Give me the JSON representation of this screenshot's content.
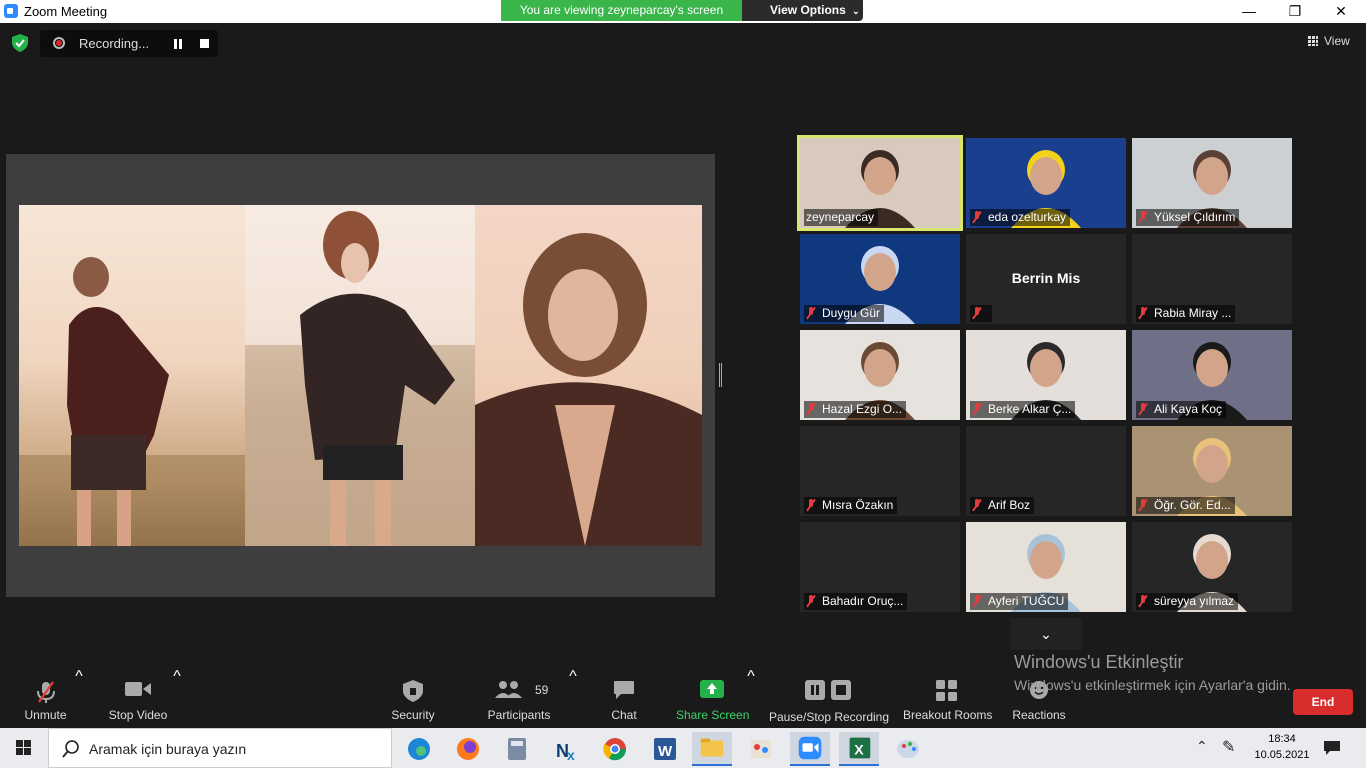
{
  "window": {
    "title": "Zoom Meeting",
    "minimize": "—",
    "restore": "❐",
    "close": "✕"
  },
  "banner": {
    "viewing": "You are viewing zeyneparcay's screen",
    "view_options": "View Options"
  },
  "recording": {
    "label": "Recording..."
  },
  "view": {
    "label": "View"
  },
  "gallery": [
    {
      "name": "zeyneparcay",
      "muted": false,
      "active": true,
      "video": true
    },
    {
      "name": "eda ozelturkay",
      "muted": true,
      "active": false,
      "video": true
    },
    {
      "name": "Yüksel Çıldırım",
      "muted": true,
      "active": false,
      "video": true
    },
    {
      "name": "Duygu Gür",
      "muted": true,
      "active": false,
      "video": true
    },
    {
      "name": "",
      "display_name": "Berrin Mis",
      "muted": true,
      "active": false,
      "video": false
    },
    {
      "name": "Rabia Miray ...",
      "muted": true,
      "active": false,
      "video": false
    },
    {
      "name": "Hazal Ezgi O...",
      "muted": true,
      "active": false,
      "video": true
    },
    {
      "name": "Berke Alkar Ç...",
      "muted": true,
      "active": false,
      "video": true
    },
    {
      "name": "Ali Kaya Koç",
      "muted": true,
      "active": false,
      "video": true
    },
    {
      "name": "Mısra Özakın",
      "muted": true,
      "active": false,
      "video": false
    },
    {
      "name": "Arif Boz",
      "muted": true,
      "active": false,
      "video": false
    },
    {
      "name": "Öğr. Gör. Ed...",
      "muted": true,
      "active": false,
      "video": true
    },
    {
      "name": "Bahadır Oruç...",
      "muted": true,
      "active": false,
      "video": false
    },
    {
      "name": "Ayferi TUĞCU",
      "muted": true,
      "active": false,
      "video": true
    },
    {
      "name": "süreyya yılmaz",
      "muted": true,
      "active": false,
      "video": true
    }
  ],
  "toolbar": {
    "unmute": "Unmute",
    "stop_video": "Stop Video",
    "security": "Security",
    "participants": "Participants",
    "participants_count": "59",
    "chat": "Chat",
    "share_screen": "Share Screen",
    "pause_stop_recording": "Pause/Stop Recording",
    "breakout_rooms": "Breakout Rooms",
    "reactions": "Reactions",
    "end": "End"
  },
  "activation": {
    "line1": "Windows'u Etkinleştir",
    "line2": "Windows'u etkinleştirmek için Ayarlar'a gidin."
  },
  "taskbar": {
    "search_placeholder": "Aramak için buraya yazın",
    "time": "18:34",
    "date": "10.05.2021"
  },
  "colors": {
    "banner_green": "#3ab54a",
    "active_speaker": "#d9e66d",
    "end_red": "#d92d2d",
    "share_green": "#24b04a"
  }
}
